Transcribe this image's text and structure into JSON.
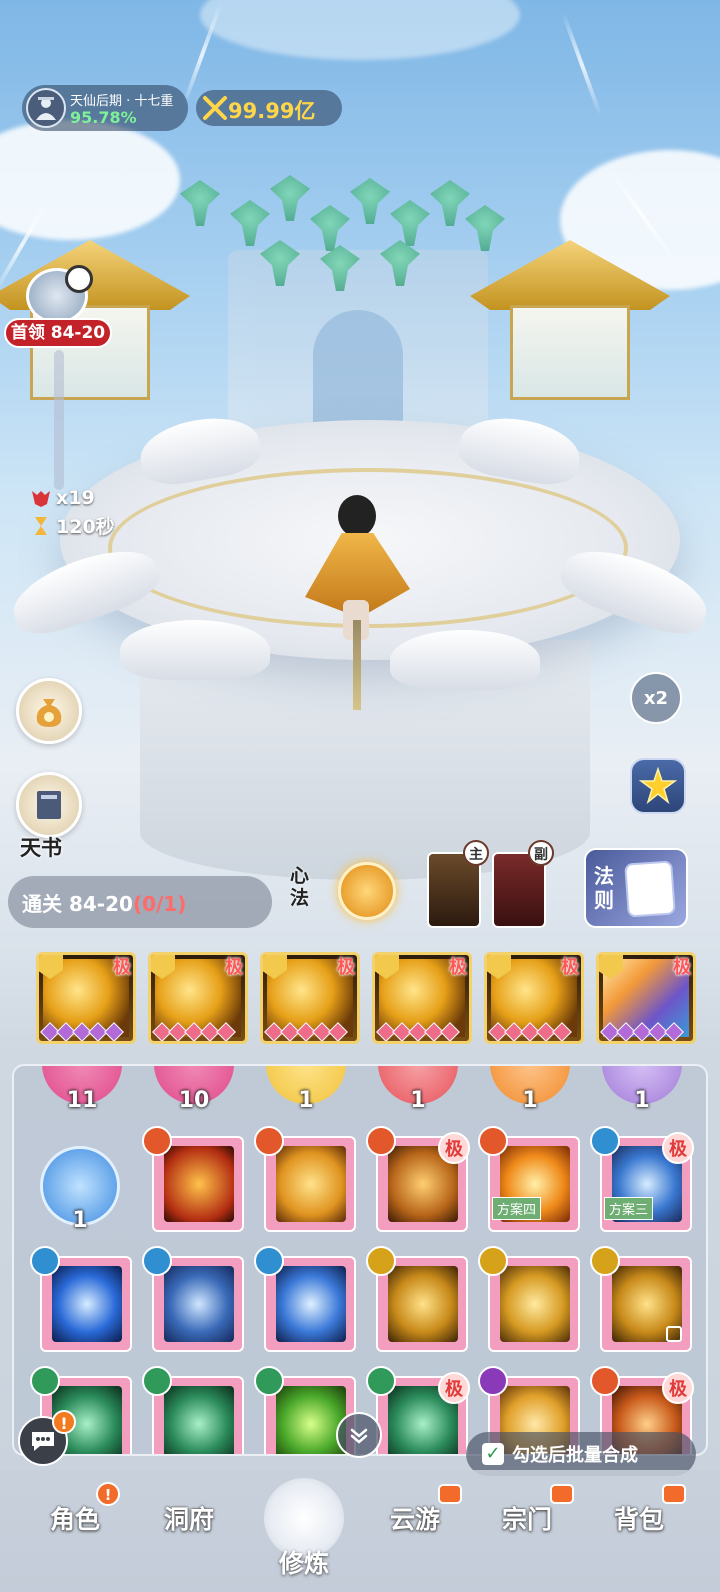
{
  "hud": {
    "realm_title": "天仙后期 · 十七重",
    "realm_progress": "95.78%",
    "power_value": "99.99亿"
  },
  "boss": {
    "label": "首领 84-20",
    "kills": "x19",
    "timer": "120秒"
  },
  "side": {
    "tianshu_label": "天书",
    "speed_label": "x2"
  },
  "middle": {
    "stage_prefix": "通关 84-20",
    "stage_count": "(0/1)",
    "xinfa_label": "心法",
    "main_tag": "主",
    "sub_tag": "副",
    "fate_label": "法则"
  },
  "equip": {
    "rank": "极",
    "slots": [
      {
        "gem_color": "#b26ad8"
      },
      {
        "gem_color": "#ef6b8a"
      },
      {
        "gem_color": "#ef6b8a"
      },
      {
        "gem_color": "#ef6b8a"
      },
      {
        "gem_color": "#ef6b8a"
      },
      {
        "gem_color": "#b26ad8"
      }
    ]
  },
  "bag": {
    "orbs": [
      {
        "count": "11",
        "color": "#e0488a"
      },
      {
        "count": "10",
        "color": "#e0488a"
      },
      {
        "count": "1",
        "color": "#f0c23a"
      },
      {
        "count": "1",
        "color": "#e8525a"
      },
      {
        "count": "1",
        "color": "#f08a2a"
      },
      {
        "count": "1",
        "color": "#a27ad8"
      }
    ],
    "blue_orb_count": "1",
    "rank": "极",
    "plan_four": "方案四",
    "plan_three": "方案三",
    "combine_label": "勾选后批量合成",
    "check_mark": "✓"
  },
  "chat": {
    "alert": "!"
  },
  "nav": {
    "items": [
      "角色",
      "洞府",
      "修炼",
      "云游",
      "宗门",
      "背包"
    ],
    "alert": "!"
  },
  "colors": {
    "accent_gold": "#ffd54a",
    "progress_green": "#7ef09a",
    "boss_red": "#c4222a",
    "stage_count_red": "#ff6a6a"
  }
}
